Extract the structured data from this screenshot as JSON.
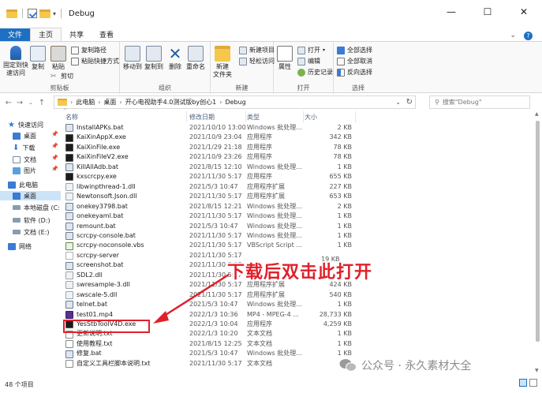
{
  "window": {
    "title": "Debug",
    "controls": {
      "minimize": "—",
      "maximize": "☐",
      "close": "✕"
    }
  },
  "ribbon_tabs": [
    {
      "label": "文件"
    },
    {
      "label": "主页"
    },
    {
      "label": "共享"
    },
    {
      "label": "查看"
    }
  ],
  "ribbon": {
    "clipboard": {
      "label": "剪贴板",
      "pin": "固定到快\n速访问",
      "copy": "复制",
      "paste": "粘贴",
      "copy_path": "复制路径",
      "paste_shortcut": "粘贴快捷方式",
      "cut": "剪切"
    },
    "organize": {
      "label": "组织",
      "move_to": "移动到",
      "copy_to": "复制到",
      "delete": "删除",
      "rename": "重命名"
    },
    "new": {
      "label": "新建",
      "new_folder": "新建\n文件夹",
      "new_item": "新建项目",
      "easy_access": "轻松访问"
    },
    "open": {
      "label": "打开",
      "properties": "属性",
      "open": "打开",
      "edit": "编辑",
      "history": "历史记录"
    },
    "select": {
      "label": "选择",
      "select_all": "全部选择",
      "select_none": "全部取消",
      "invert": "反向选择"
    }
  },
  "address": {
    "crumbs": [
      "此电脑",
      "桌面",
      "开心电视助手4.0测试版by创心1",
      "Debug"
    ],
    "search_placeholder": "搜索\"Debug\""
  },
  "nav": {
    "items": [
      {
        "label": "快速访问",
        "icon": "star-icon"
      },
      {
        "label": "桌面",
        "icon": "desktop-icon"
      },
      {
        "label": "下载",
        "icon": "download-icon"
      },
      {
        "label": "文档",
        "icon": "document-icon"
      },
      {
        "label": "图片",
        "icon": "picture-icon"
      },
      {
        "label": "此电脑",
        "icon": "computer-icon"
      },
      {
        "label": "桌面",
        "icon": "desktop-icon"
      },
      {
        "label": "本地磁盘 (C:",
        "icon": "drive-icon"
      },
      {
        "label": "软件 (D:)",
        "icon": "drive-icon"
      },
      {
        "label": "文档 (E:)",
        "icon": "drive-icon"
      },
      {
        "label": "网络",
        "icon": "network-icon"
      }
    ]
  },
  "columns": {
    "name": "名称",
    "date": "修改日期",
    "type": "类型",
    "size": "大小"
  },
  "files": [
    {
      "name": "InstallAPKs.bat",
      "date": "2021/10/10 13:00",
      "type": "Windows 批处理...",
      "size": "2 KB",
      "icon": "bat"
    },
    {
      "name": "KaiXinAppX.exe",
      "date": "2021/10/9 23:04",
      "type": "应用程序",
      "size": "342 KB",
      "icon": "exe"
    },
    {
      "name": "KaiXinFile.exe",
      "date": "2021/1/29 21:18",
      "type": "应用程序",
      "size": "78 KB",
      "icon": "exe"
    },
    {
      "name": "KaiXinFileV2.exe",
      "date": "2021/10/9 23:26",
      "type": "应用程序",
      "size": "78 KB",
      "icon": "exe"
    },
    {
      "name": "KillAllAdb.bat",
      "date": "2021/8/15 12:10",
      "type": "Windows 批处理...",
      "size": "1 KB",
      "icon": "bat"
    },
    {
      "name": "kxscrcpy.exe",
      "date": "2021/11/30 5:17",
      "type": "应用程序",
      "size": "655 KB",
      "icon": "exe"
    },
    {
      "name": "libwinpthread-1.dll",
      "date": "2021/5/3 10:47",
      "type": "应用程序扩展",
      "size": "227 KB",
      "icon": "dll"
    },
    {
      "name": "Newtonsoft.Json.dll",
      "date": "2021/11/30 5:17",
      "type": "应用程序扩展",
      "size": "653 KB",
      "icon": "dll"
    },
    {
      "name": "onekey3798.bat",
      "date": "2021/8/15 12:21",
      "type": "Windows 批处理...",
      "size": "2 KB",
      "icon": "bat"
    },
    {
      "name": "onekeyaml.bat",
      "date": "2021/11/30 5:17",
      "type": "Windows 批处理...",
      "size": "1 KB",
      "icon": "bat"
    },
    {
      "name": "remount.bat",
      "date": "2021/5/3 10:47",
      "type": "Windows 批处理...",
      "size": "1 KB",
      "icon": "bat"
    },
    {
      "name": "scrcpy-console.bat",
      "date": "2021/11/30 5:17",
      "type": "Windows 批处理...",
      "size": "1 KB",
      "icon": "bat"
    },
    {
      "name": "scrcpy-noconsole.vbs",
      "date": "2021/11/30 5:17",
      "type": "VBScript Script ...",
      "size": "1 KB",
      "icon": "vbs"
    },
    {
      "name": "scrcpy-server",
      "date": "2021/11/30 5:17",
      "type": "",
      "size": "",
      "icon": "file"
    },
    {
      "name": "screenshot.bat",
      "date": "2021/11/30 5:17",
      "type": "",
      "size": "",
      "icon": "bat"
    },
    {
      "name": "SDL2.dll",
      "date": "2021/11/30 5:17",
      "type": "",
      "size": "",
      "icon": "dll"
    },
    {
      "name": "swresample-3.dll",
      "date": "2021/11/30 5:17",
      "type": "应用程序扩展",
      "size": "424 KB",
      "icon": "dll"
    },
    {
      "name": "swscale-5.dll",
      "date": "2021/11/30 5:17",
      "type": "应用程序扩展",
      "size": "540 KB",
      "icon": "dll"
    },
    {
      "name": "telnet.bat",
      "date": "2021/5/3 10:47",
      "type": "Windows 批处理...",
      "size": "1 KB",
      "icon": "bat"
    },
    {
      "name": "test01.mp4",
      "date": "2022/1/3 10:36",
      "type": "MP4 - MPEG-4 ...",
      "size": "28,733 KB",
      "icon": "mp4"
    },
    {
      "name": "YesStbToolV4D.exe",
      "date": "2022/1/3 10:04",
      "type": "应用程序",
      "size": "4,259 KB",
      "icon": "exe"
    },
    {
      "name": "更新说明.txt",
      "date": "2022/1/3 10:20",
      "type": "文本文档",
      "size": "1 KB",
      "icon": "txt"
    },
    {
      "name": "使用教程.txt",
      "date": "2021/8/15 12:25",
      "type": "文本文档",
      "size": "1 KB",
      "icon": "txt"
    },
    {
      "name": "修复.bat",
      "date": "2021/5/3 10:47",
      "type": "Windows 批处理...",
      "size": "1 KB",
      "icon": "bat"
    },
    {
      "name": "自定义工具栏脚本说明.txt",
      "date": "2021/11/30 5:17",
      "type": "文本文档",
      "size": "",
      "icon": "txt"
    }
  ],
  "overlay_size_partial": "19 KB",
  "annotation": "下载后双击此打开",
  "status": {
    "count": "48 个项目"
  },
  "watermark": "公众号 · 永久素材大全",
  "colors": {
    "accent": "#1e6fc1",
    "annotation": "#e0202a"
  }
}
